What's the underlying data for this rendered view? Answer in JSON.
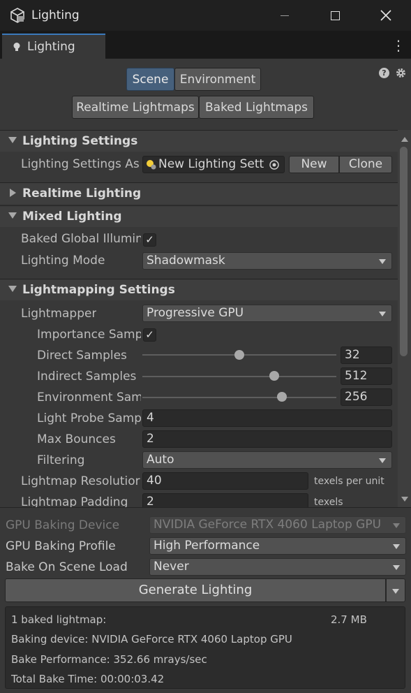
{
  "window": {
    "title": "Lighting",
    "tab_label": "Lighting"
  },
  "toolbar": {
    "scene_tab": "Scene",
    "environment_tab": "Environment",
    "realtime_lightmaps_tab": "Realtime Lightmaps",
    "baked_lightmaps_tab": "Baked Lightmaps"
  },
  "lighting_settings": {
    "header": "Lighting Settings",
    "asset_label": "Lighting Settings As",
    "asset_value": "New Lighting Sett",
    "new_button": "New",
    "clone_button": "Clone"
  },
  "realtime_lighting": {
    "header": "Realtime Lighting"
  },
  "mixed_lighting": {
    "header": "Mixed Lighting",
    "baked_gi_label": "Baked Global Illumin",
    "baked_gi_checked": true,
    "lighting_mode_label": "Lighting Mode",
    "lighting_mode_value": "Shadowmask"
  },
  "lightmapping": {
    "header": "Lightmapping Settings",
    "lightmapper_label": "Lightmapper",
    "lightmapper_value": "Progressive GPU",
    "importance_label": "Importance Samp",
    "importance_checked": true,
    "direct_label": "Direct Samples",
    "direct_value": "32",
    "direct_slider": 0.5,
    "indirect_label": "Indirect Samples",
    "indirect_value": "512",
    "indirect_slider": 0.68,
    "environment_label": "Environment Sam",
    "environment_value": "256",
    "environment_slider": 0.72,
    "light_probe_label": "Light Probe Samp",
    "light_probe_value": "4",
    "max_bounces_label": "Max Bounces",
    "max_bounces_value": "2",
    "filtering_label": "Filtering",
    "filtering_value": "Auto",
    "resolution_label": "Lightmap Resolutior",
    "resolution_value": "40",
    "resolution_unit": "texels per unit",
    "padding_label": "Lightmap Padding",
    "padding_value": "2",
    "padding_unit": "texels"
  },
  "bake": {
    "device_label": "GPU Baking Device",
    "device_value": "NVIDIA GeForce RTX 4060 Laptop GPU",
    "profile_label": "GPU Baking Profile",
    "profile_value": "High Performance",
    "scene_load_label": "Bake On Scene Load",
    "scene_load_value": "Never",
    "generate_button": "Generate Lighting"
  },
  "stats": {
    "lightmaps": "1 baked lightmap:",
    "size": "2.7 MB",
    "device": "Baking device: NVIDIA GeForce RTX 4060 Laptop GPU",
    "performance": "Bake Performance: 352.66 mrays/sec",
    "time": "Total Bake Time: 00:00:03.42"
  },
  "colors": {
    "accent": "#3a79bb",
    "active_tab": "#46607c",
    "background": "#383838"
  }
}
